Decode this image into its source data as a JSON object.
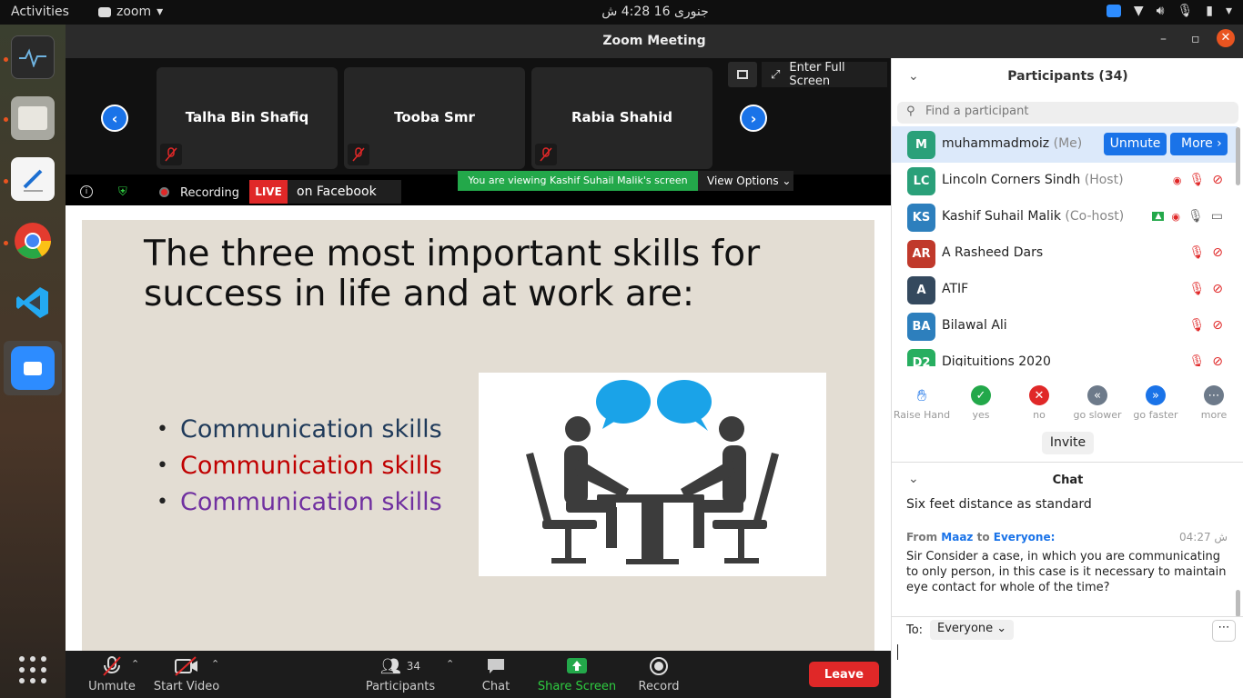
{
  "topbar": {
    "activities": "Activities",
    "app_name": "zoom",
    "clock": "جنوری 16  4:28 ش"
  },
  "window": {
    "title": "Zoom Meeting"
  },
  "strip": {
    "full_screen": "Enter Full Screen",
    "tiles": [
      {
        "name": "Talha Bin Shafiq"
      },
      {
        "name": "Tooba Smr"
      },
      {
        "name": "Rabia Shahid"
      }
    ]
  },
  "info": {
    "recording": "Recording",
    "live_badge": "LIVE",
    "live_target": "on Facebook",
    "viewing": "You are viewing Kashif Suhail Malik's screen",
    "view_options": "View Options"
  },
  "slide": {
    "heading_line1": "The three most important skills for",
    "heading_line2": "success in life and at work are:",
    "bullets": [
      {
        "text": "Communication skills",
        "color": "#1f3a5a"
      },
      {
        "text": "Communication skills",
        "color": "#c00000"
      },
      {
        "text": "Communication skills",
        "color": "#7030a0"
      }
    ]
  },
  "toolbar": {
    "unmute": "Unmute",
    "start_video": "Start Video",
    "participants": "Participants",
    "participants_count": "34",
    "chat": "Chat",
    "share_screen": "Share Screen",
    "record": "Record",
    "leave": "Leave"
  },
  "participants": {
    "title": "Participants (34)",
    "search_placeholder": "Find a participant",
    "unmute_btn": "Unmute",
    "more_btn": "More",
    "list": [
      {
        "initials": "M",
        "name": "muhammadmoiz",
        "role": "(Me)",
        "color": "#2aa079"
      },
      {
        "initials": "LC",
        "name": "Lincoln Corners Sindh",
        "role": "(Host)",
        "color": "#2aa079"
      },
      {
        "initials": "KS",
        "name": "Kashif Suhail Malik",
        "role": "(Co-host)",
        "color": "#2d7fbd"
      },
      {
        "initials": "AR",
        "name": "A Rasheed Dars",
        "role": "",
        "color": "#c0392b"
      },
      {
        "initials": "A",
        "name": "ATIF",
        "role": "",
        "color": "#34495e"
      },
      {
        "initials": "BA",
        "name": "Bilawal Ali",
        "role": "",
        "color": "#2d7fbd"
      },
      {
        "initials": "D2",
        "name": "Digituitions 2020",
        "role": "",
        "color": "#27ae60"
      }
    ],
    "reactions": [
      {
        "label": "Raise Hand"
      },
      {
        "label": "yes"
      },
      {
        "label": "no"
      },
      {
        "label": "go slower"
      },
      {
        "label": "go faster"
      },
      {
        "label": "more"
      }
    ],
    "invite": "Invite"
  },
  "chat": {
    "title": "Chat",
    "prev_message": "Six feet distance as standard",
    "msg_from_label": "From",
    "msg_sender": "Maaz",
    "msg_to_label": "to",
    "msg_recipient": "Everyone:",
    "msg_time": "04:27 ش",
    "msg_text": "Sir Consider a case, in which you are communicating to only person, in this case is it necessary to maintain eye contact for whole of the time?",
    "to_label": "To:",
    "to_value": "Everyone"
  }
}
